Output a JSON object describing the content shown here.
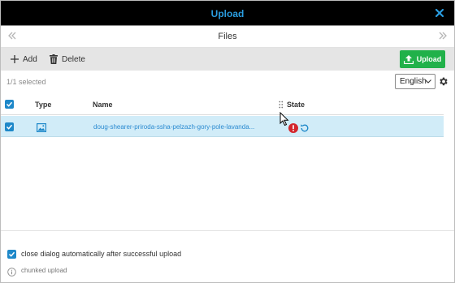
{
  "dialog": {
    "title": "Upload"
  },
  "nav": {
    "title": "Files"
  },
  "toolbar": {
    "add_label": "Add",
    "delete_label": "Delete",
    "upload_label": "Upload"
  },
  "selection": {
    "info": "1/1 selected"
  },
  "language": {
    "selected": "English"
  },
  "table": {
    "columns": {
      "type": "Type",
      "name": "Name",
      "state": "State"
    },
    "rows": [
      {
        "checked": true,
        "type_icon": "image-icon",
        "name": "doug-shearer-priroda-ssha-pelzazh-gory-pole-lavanda...",
        "state": "error"
      }
    ]
  },
  "footer": {
    "auto_close_label": "close dialog automatically after successful upload",
    "auto_close_checked": true,
    "chunked_label": "chunked upload"
  },
  "colors": {
    "accent": "#2a9de0",
    "upload_green": "#21b14a",
    "error_red": "#d3262d",
    "row_selected": "#d1ecf8",
    "checkbox": "#1e88c9"
  }
}
